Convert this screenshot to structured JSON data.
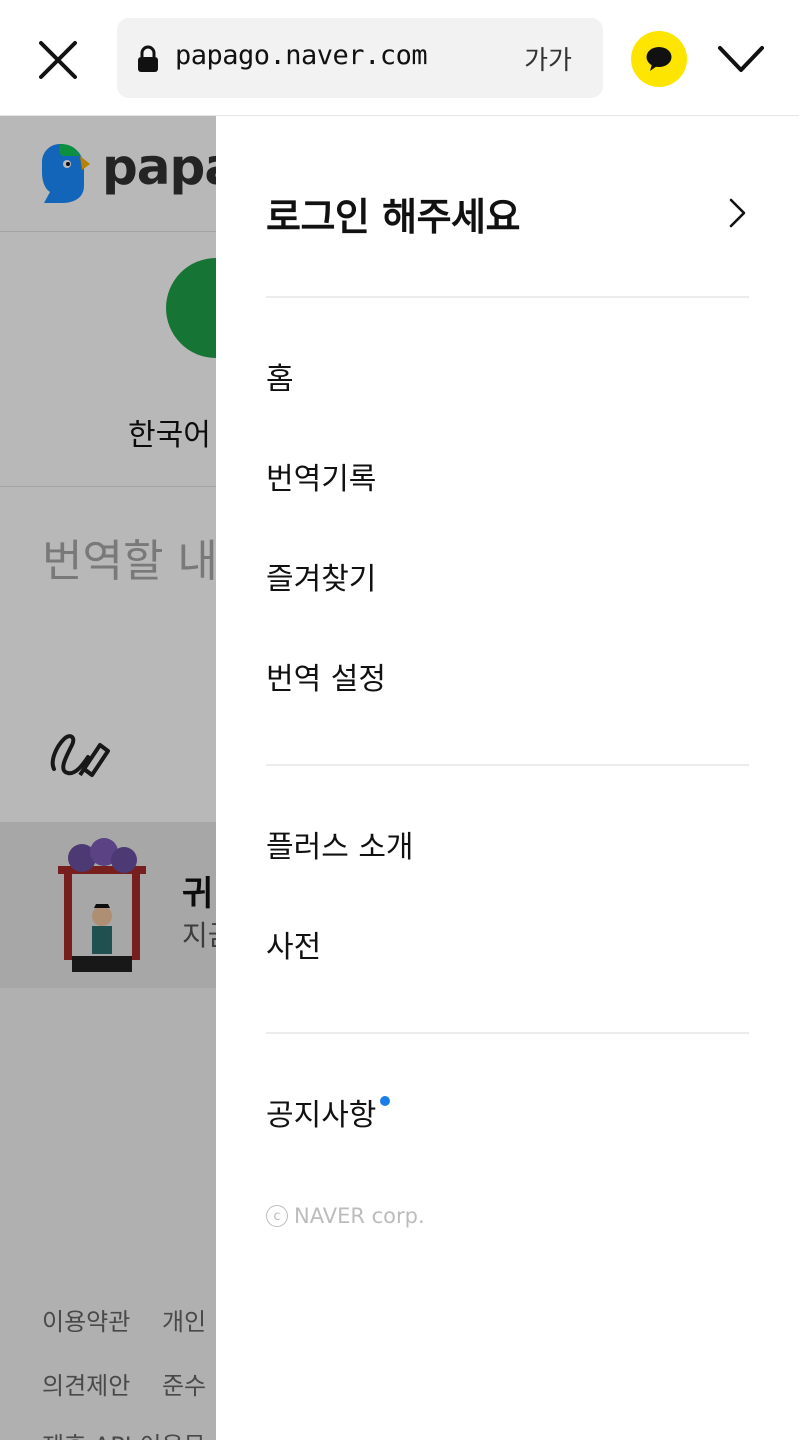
{
  "browser": {
    "url": "papago.naver.com",
    "text_size_label": "가가"
  },
  "page": {
    "brand": "papa",
    "language_label": "한국어",
    "source_placeholder": "번역할 내",
    "recent_title": "귀",
    "recent_sub": "지금",
    "footer_row1": [
      "이용약관",
      "개인"
    ],
    "footer_row2": [
      "의견제안",
      "준수"
    ],
    "footer_row3": "제휴 API 이용문"
  },
  "drawer": {
    "login_text": "로그인 해주세요",
    "menu": {
      "home": "홈",
      "history": "번역기록",
      "favorites": "즐겨찾기",
      "settings": "번역 설정",
      "plus": "플러스 소개",
      "dictionary": "사전",
      "notice": "공지사항"
    },
    "copyright_symbol": "c",
    "copyright_text": "NAVER corp."
  },
  "colors": {
    "kakao_yellow": "#fee500",
    "notice_dot": "#1b7ee8",
    "lang_circle": "#1fa34a"
  }
}
